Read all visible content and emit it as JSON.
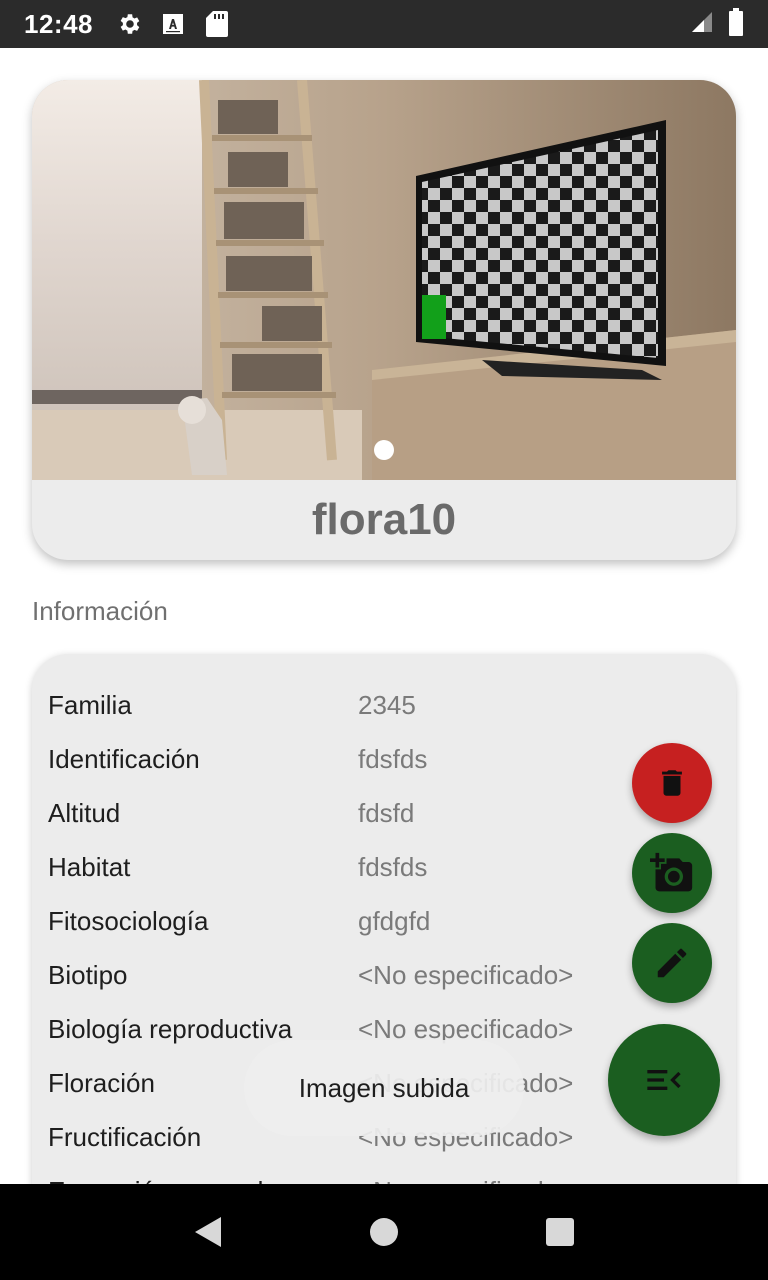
{
  "status_bar": {
    "time": "12:48",
    "icons": [
      "settings-gear-icon",
      "a-letter-icon",
      "sd-card-icon"
    ],
    "right_icons": [
      "signal-icon",
      "battery-icon"
    ]
  },
  "carousel": {
    "page_count": 1,
    "current_page": 1
  },
  "card": {
    "title": "flora10"
  },
  "section": {
    "label": "Información"
  },
  "info": [
    {
      "key": "Familia",
      "value": "2345"
    },
    {
      "key": "Identificación",
      "value": "fdsfds"
    },
    {
      "key": "Altitud",
      "value": "fdsfd"
    },
    {
      "key": "Habitat",
      "value": "fdsfds"
    },
    {
      "key": "Fitosociología",
      "value": "gfdgfd"
    },
    {
      "key": "Biotipo",
      "value": "<No especificado>"
    },
    {
      "key": "Biología reproductiva",
      "value": "<No especificado>"
    },
    {
      "key": "Floración",
      "value": "<No especificado>"
    },
    {
      "key": "Fructificación",
      "value": "<No especificado>"
    },
    {
      "key": "Expansión general",
      "value": "<No especificado>"
    }
  ],
  "fabs": {
    "delete_icon": "trash-icon",
    "camera_icon": "add-photo-icon",
    "edit_icon": "pencil-icon",
    "menu_icon": "menu-collapse-icon"
  },
  "toast": {
    "message": "Imagen subida"
  },
  "nav": {
    "back": "back-icon",
    "home": "home-icon",
    "recents": "recents-icon"
  },
  "colors": {
    "delete": "#c62020",
    "primary": "#1b5e20"
  }
}
